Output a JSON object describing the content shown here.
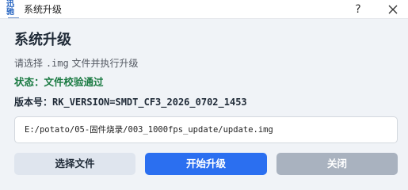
{
  "window": {
    "title": "系统升级",
    "logo_text": "迅驰",
    "help_glyph": "?"
  },
  "main": {
    "heading": "系统升级",
    "hint_prefix": "请选择 ",
    "hint_ext": ".img",
    "hint_suffix": " 文件并执行升级",
    "status_label": "状态：",
    "status_value": "文件校验通过",
    "version_label": "版本号：",
    "version_value": "RK_VERSION=SMDT_CF3_2026_0702_1453",
    "file_path": "E:/potato/05-固件烧录/003_1000fps_update/update.img"
  },
  "buttons": {
    "select_label": "选择文件",
    "start_label": "开始升级",
    "close_label": "关闭"
  },
  "colors": {
    "accent": "#2b6ff0",
    "status_ok": "#1a7a42",
    "disabled": "#a9b2bf",
    "secondary": "#dfe5ee"
  }
}
